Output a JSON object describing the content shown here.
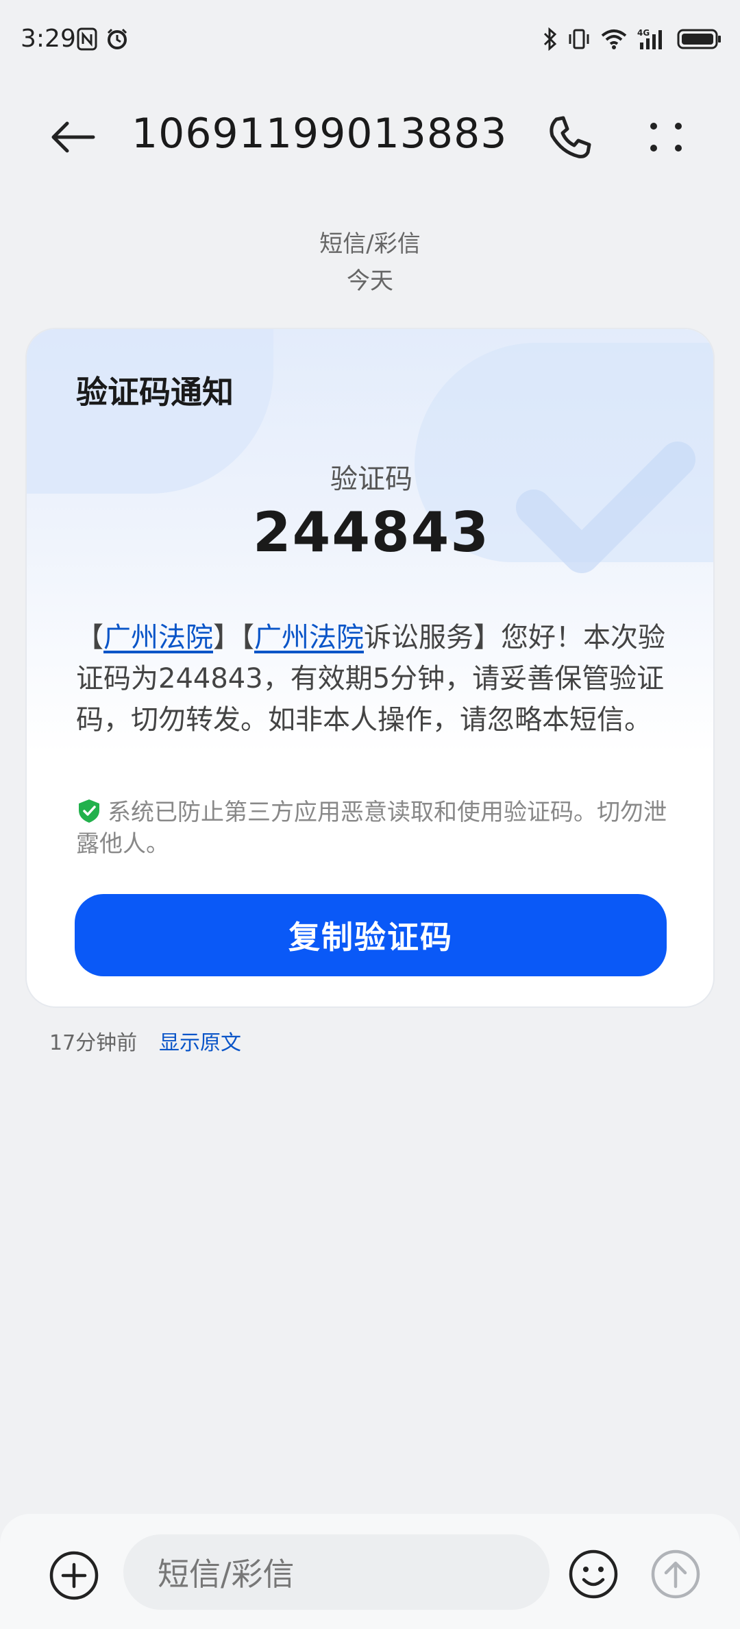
{
  "status_bar": {
    "time": "3:29",
    "icons": [
      "nfc-icon",
      "alarm-icon",
      "bluetooth-icon",
      "vibrate-icon",
      "wifi-icon",
      "signal-4g-icon",
      "battery-icon"
    ]
  },
  "header": {
    "title": "10691199013883",
    "back_icon": "arrow-left-icon",
    "call_icon": "phone-icon",
    "more_icon": "more-dots-icon"
  },
  "conversation": {
    "type_label": "短信/彩信",
    "date_label": "今天"
  },
  "card": {
    "title": "验证码通知",
    "code_label": "验证码",
    "code_value": "244843",
    "body": {
      "bracket_open_1": "【",
      "link_1": "广州法院",
      "bracket_close_1": "】",
      "bracket_open_2": "【",
      "link_2": "广州法院",
      "rest": "诉讼服务】您好！本次验证码为244843，有效期5分钟，请妥善保管验证码，切勿转发。如非本人操作，请忽略本短信。"
    },
    "security_note": "系统已防止第三方应用恶意读取和使用验证码。切勿泄露他人。",
    "copy_button_label": "复制验证码",
    "colors": {
      "accent": "#0a59f7",
      "link": "#0a55c8",
      "shield": "#22b14c"
    }
  },
  "meta": {
    "time_ago": "17分钟前",
    "show_original": "显示原文"
  },
  "input_bar": {
    "placeholder": "短信/彩信",
    "add_icon": "plus-circle-icon",
    "emoji_icon": "smiley-icon",
    "send_icon": "send-arrow-icon"
  }
}
